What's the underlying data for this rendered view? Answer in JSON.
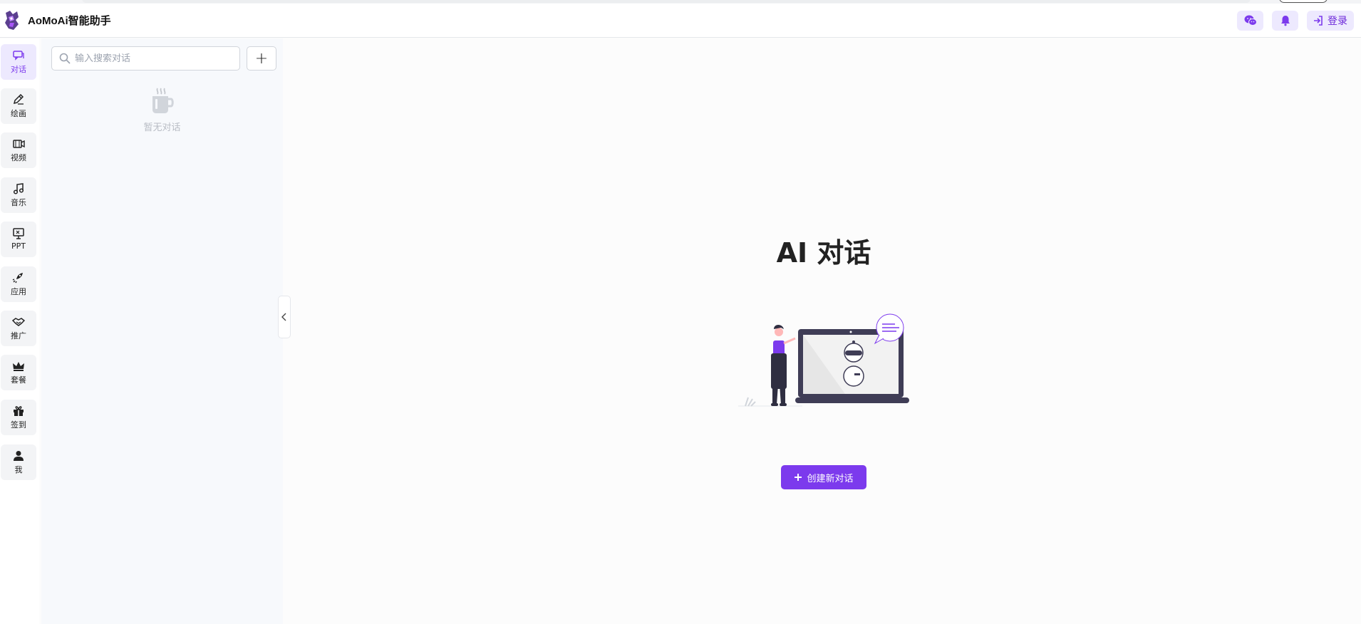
{
  "app": {
    "brand": "AoMoAi智能助手"
  },
  "header": {
    "wechat_icon": "wechat-icon",
    "bell_icon": "bell-icon",
    "login_label": "登录",
    "accent": "#7c3aed",
    "accent_soft": "#ede9fe"
  },
  "sidebar": {
    "items": [
      {
        "label": "对话",
        "icon": "chat-icon",
        "active": true
      },
      {
        "label": "绘画",
        "icon": "pen-icon"
      },
      {
        "label": "视频",
        "icon": "video-icon"
      },
      {
        "label": "音乐",
        "icon": "music-icon"
      },
      {
        "label": "PPT",
        "icon": "presentation-icon"
      },
      {
        "label": "应用",
        "icon": "rocket-icon"
      },
      {
        "label": "推广",
        "icon": "handshake-icon"
      },
      {
        "label": "套餐",
        "icon": "crown-icon"
      },
      {
        "label": "签到",
        "icon": "gift-icon"
      },
      {
        "label": "我",
        "icon": "user-icon"
      }
    ]
  },
  "panel": {
    "search_placeholder": "输入搜索对话",
    "add_label": "+",
    "empty_text": "暂无对话"
  },
  "main": {
    "title": "AI 对话",
    "cta_label": "创建新对话"
  }
}
